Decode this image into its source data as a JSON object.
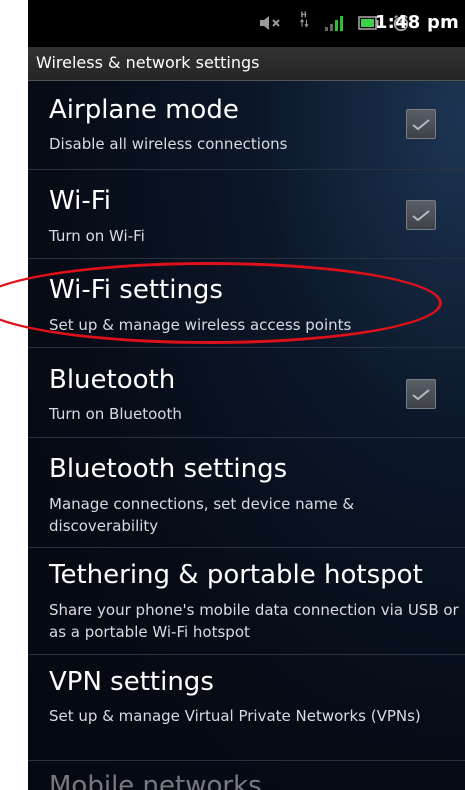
{
  "status_bar": {
    "time": "1:48 pm",
    "icons": [
      "mute-icon",
      "hspa-icon",
      "signal-icon",
      "battery-icon",
      "alarm-icon"
    ]
  },
  "header": {
    "title": "Wireless & network settings"
  },
  "settings": [
    {
      "title": "Airplane mode",
      "subtitle": "Disable all wireless connections",
      "checkbox": true,
      "checked": true
    },
    {
      "title": "Wi-Fi",
      "subtitle": "Turn on Wi-Fi",
      "checkbox": true,
      "checked": true
    },
    {
      "title": "Wi-Fi settings",
      "subtitle": "Set up & manage wireless access points",
      "checkbox": false,
      "highlighted": true
    },
    {
      "title": "Bluetooth",
      "subtitle": "Turn on Bluetooth",
      "checkbox": true,
      "checked": true
    },
    {
      "title": "Bluetooth settings",
      "subtitle": "Manage connections, set device name & discoverability",
      "checkbox": false
    },
    {
      "title": "Tethering & portable hotspot",
      "subtitle": "Share your phone's mobile data connection via USB or as a portable Wi-Fi hotspot",
      "checkbox": false
    },
    {
      "title": "VPN settings",
      "subtitle": "Set up & manage Virtual Private Networks (VPNs)",
      "checkbox": false
    },
    {
      "title": "Mobile networks",
      "subtitle": "",
      "checkbox": false
    }
  ],
  "colors": {
    "highlight": "#e0101a",
    "background": "#050a14"
  }
}
